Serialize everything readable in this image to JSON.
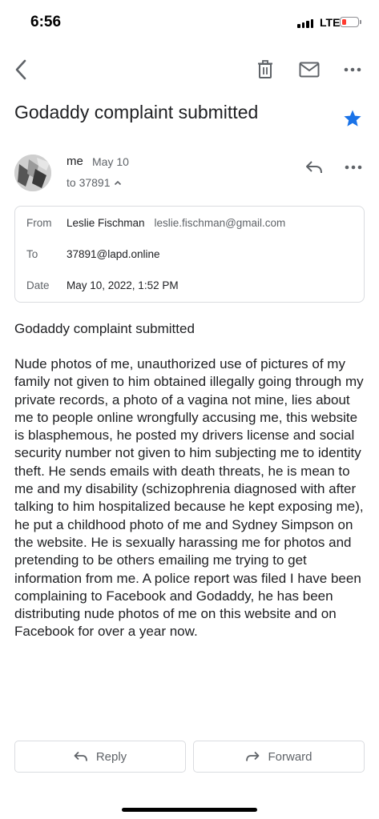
{
  "status_bar": {
    "time": "6:56",
    "network": "LTE",
    "battery_level": 0.15
  },
  "toolbar": {
    "back_icon": "back-arrow-icon",
    "delete_icon": "trash-icon",
    "mark_unread_icon": "mail-icon",
    "more_icon": "more-horizontal-icon"
  },
  "email": {
    "subject": "Godaddy complaint submitted",
    "starred": true,
    "sender": "me",
    "date_short": "May 10",
    "to_line": "to 37891",
    "details": {
      "from_label": "From",
      "from_name": "Leslie Fischman",
      "from_email": "leslie.fischman@gmail.com",
      "to_label": "To",
      "to_value": "37891@lapd.online",
      "date_label": "Date",
      "date_value": "May 10, 2022, 1:52 PM"
    },
    "body_subject": "Godaddy complaint submitted",
    "body": "Nude photos of me, unauthorized use of pictures of my family not given to him obtained illegally going through my private records, a photo of a vagina not mine, lies about me to people online wrongfully accusing me, this website is blasphemous, he posted my drivers license and social security number not given to him subjecting me to identity theft. He sends emails with death threats, he is mean to me and my disability (schizophrenia diagnosed with after talking to him hospitalized because he kept exposing me), he put a childhood photo of me and Sydney Simpson on the website. He is sexually harassing me for photos and pretending to be others emailing me trying to get information from me. A police report was filed I have been complaining to Facebook and Godaddy, he has been distributing nude photos of me on this website and on Facebook for over a year now."
  },
  "actions": {
    "reply_label": "Reply",
    "forward_label": "Forward"
  },
  "colors": {
    "star": "#1a73e8",
    "icon": "#5f6368",
    "battery_low": "#ff3b30"
  }
}
